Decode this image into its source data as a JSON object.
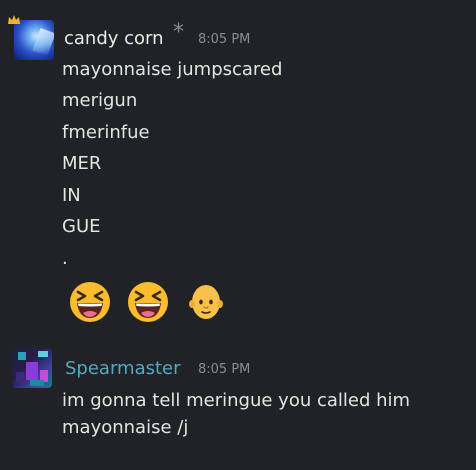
{
  "messages": [
    {
      "author": "candy corn",
      "badge_glyph": "*",
      "time": "8:05 PM",
      "lines": [
        "mayonnaise jumpscared",
        "merigun",
        "fmerinfue",
        "MER",
        "IN",
        "GUE",
        "."
      ],
      "emojis": [
        "laughing-face",
        "laughing-face",
        "bald-person-face"
      ],
      "avatar": "candy-corn-avatar",
      "crown_color": "#f0b232"
    },
    {
      "author": "Spearmaster",
      "time": "8:05 PM",
      "lines": [
        "im gonna tell meringue you called him",
        "mayonnaise /j"
      ],
      "avatar": "spearmaster-avatar",
      "name_color": "#56a6c4"
    }
  ]
}
